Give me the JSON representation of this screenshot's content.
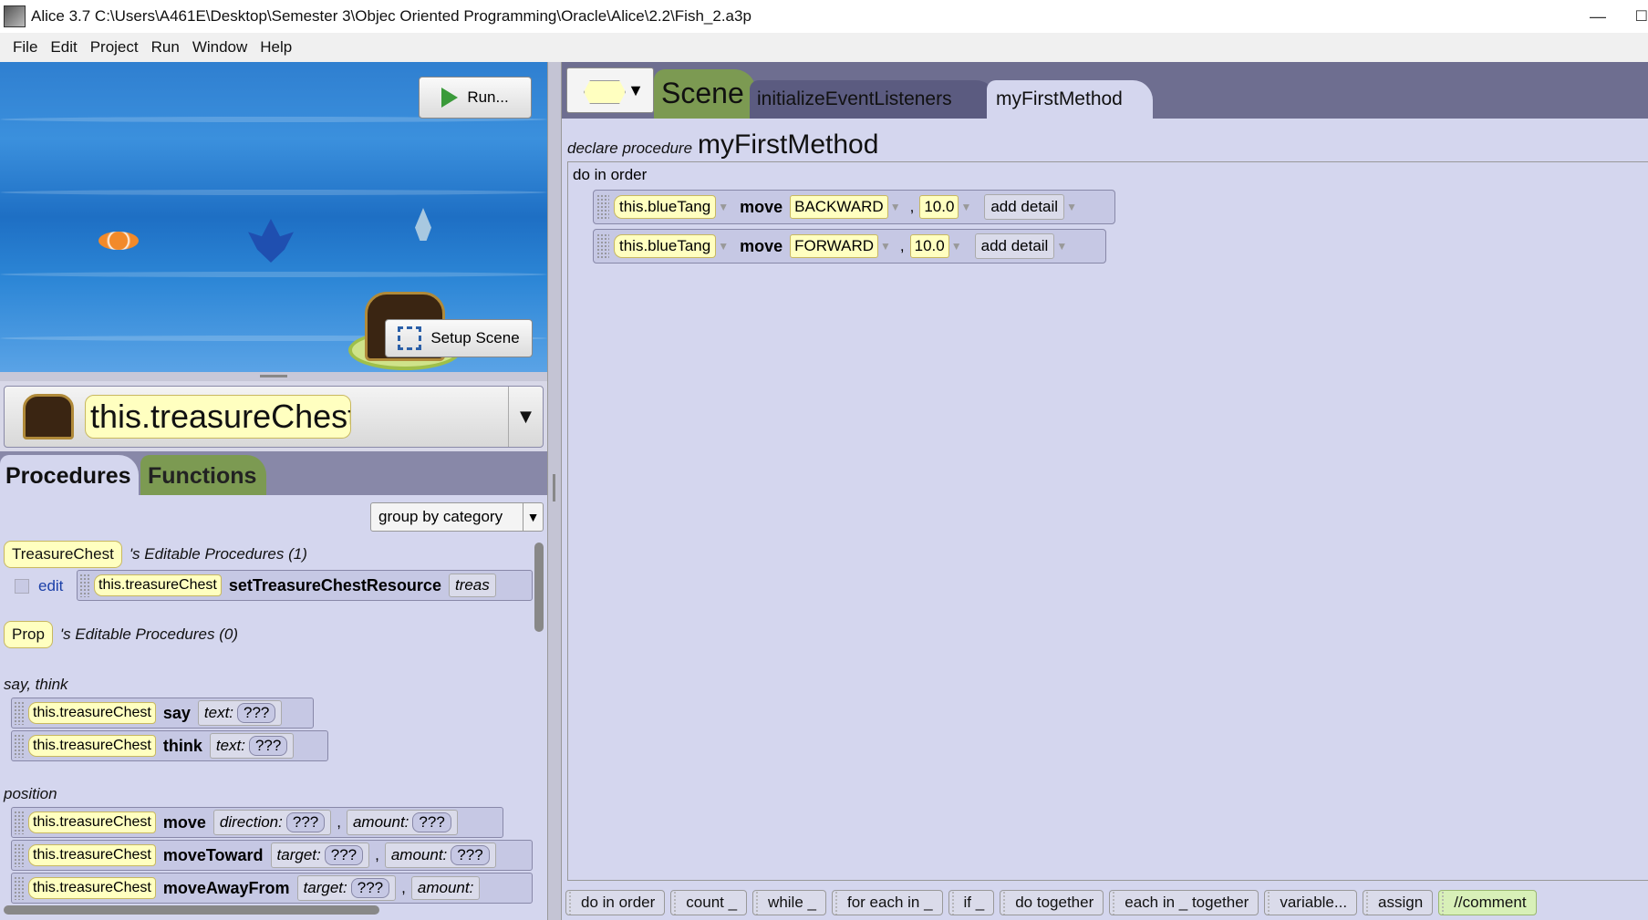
{
  "window": {
    "title": "Alice 3.7 C:\\Users\\A461E\\Desktop\\Semester 3\\Objec Oriented Programming\\Oracle\\Alice\\2.2\\Fish_2.a3p",
    "minimize": "—",
    "edge": "☐"
  },
  "menu": [
    "File",
    "Edit",
    "Project",
    "Run",
    "Window",
    "Help"
  ],
  "scene": {
    "run_label": "Run...",
    "setup_label": "Setup Scene"
  },
  "selected_object": "this.treasureChest",
  "left_tabs": {
    "procedures": "Procedures",
    "functions": "Functions"
  },
  "group_by": "group by category",
  "editable": [
    {
      "type": "TreasureChest",
      "label": "'s Editable Procedures (1)"
    },
    {
      "type": "Prop",
      "label": "'s Editable Procedures (0)"
    }
  ],
  "editable_method": {
    "edit": "edit",
    "target": "this.treasureChest",
    "name": "setTreasureChestResource",
    "param": "treas"
  },
  "categories": {
    "say_think": "say, think",
    "position": "position"
  },
  "procedures": [
    {
      "target": "this.treasureChest",
      "name": "say",
      "p1": "text:",
      "v1": "???",
      "p2": "",
      "v2": ""
    },
    {
      "target": "this.treasureChest",
      "name": "think",
      "p1": "text:",
      "v1": "???",
      "p2": "",
      "v2": ""
    },
    {
      "target": "this.treasureChest",
      "name": "move",
      "p1": "direction:",
      "v1": "???",
      "p2": "amount:",
      "v2": "???"
    },
    {
      "target": "this.treasureChest",
      "name": "moveToward",
      "p1": "target:",
      "v1": "???",
      "p2": "amount:",
      "v2": "???"
    },
    {
      "target": "this.treasureChest",
      "name": "moveAwayFrom",
      "p1": "target:",
      "v1": "???",
      "p2": "amount:",
      "v2": ""
    }
  ],
  "right_tabs": {
    "scene": "Scene",
    "init": "initializeEventListeners",
    "method": "myFirstMethod"
  },
  "editor": {
    "declare": "declare procedure",
    "method_name": "myFirstMethod",
    "do_in_order": "do in order",
    "statements": [
      {
        "target": "this.blueTang",
        "method": "move",
        "direction": "BACKWARD",
        "amount": "10.0",
        "detail": "add detail"
      },
      {
        "target": "this.blueTang",
        "method": "move",
        "direction": "FORWARD",
        "amount": "10.0",
        "detail": "add detail"
      }
    ]
  },
  "controls": [
    "do in order",
    "count _",
    "while _",
    "for each in _",
    "if _",
    "do together",
    "each in _ together",
    "variable...",
    "assign",
    "//comment"
  ]
}
